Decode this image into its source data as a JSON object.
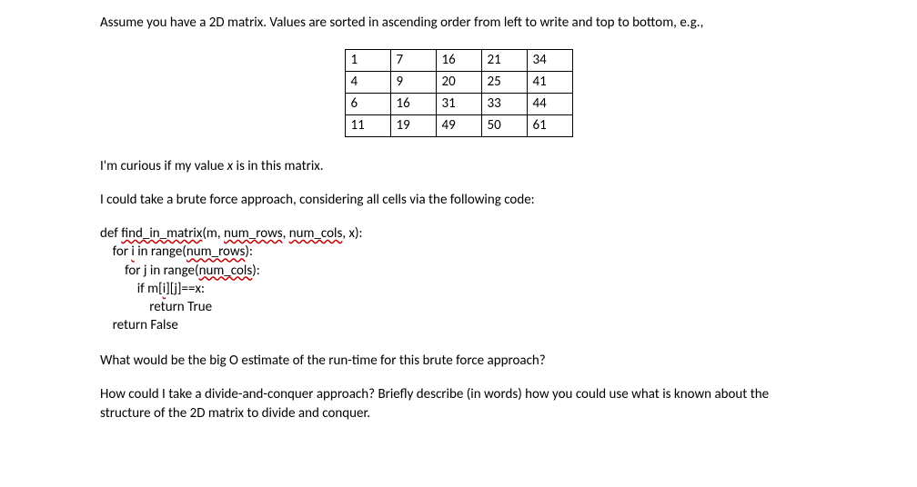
{
  "p1": "Assume you have a 2D matrix. Values are sorted in ascending order from left to write and top to bottom, e.g.,",
  "matrix": [
    [
      "1",
      "7",
      "16",
      "21",
      "34"
    ],
    [
      "4",
      "9",
      "20",
      "25",
      "41"
    ],
    [
      "6",
      "16",
      "31",
      "33",
      "44"
    ],
    [
      "11",
      "19",
      "49",
      "50",
      "61"
    ]
  ],
  "p2a": "I'm curious if my value ",
  "p2b": "x",
  "p2c": " is in this matrix.",
  "p3": "I could take a brute force approach, considering all cells via the following code:",
  "code": {
    "l1a": "def ",
    "l1b": "find_in_matrix",
    "l1c": "(m, ",
    "l1d": "num_rows",
    "l1e": ", ",
    "l1f": "num_cols",
    "l1g": ", x):",
    "l2a": "    for ",
    "l2b": "i",
    "l2c": " in range(",
    "l2d": "num_rows",
    "l2e": "):",
    "l3a": "        for j in range(",
    "l3b": "num_cols",
    "l3c": "):",
    "l4a": "            if m[",
    "l4b": "i",
    "l4c": "][j]==x:",
    "l5": "                return True",
    "l6": "    return False"
  },
  "p4": "What would be the big O estimate of the run-time for this brute force approach?",
  "p5": "How could I take a divide-and-conquer approach? Briefly describe (in words) how you could use what is known about the structure of the 2D matrix to divide and conquer."
}
